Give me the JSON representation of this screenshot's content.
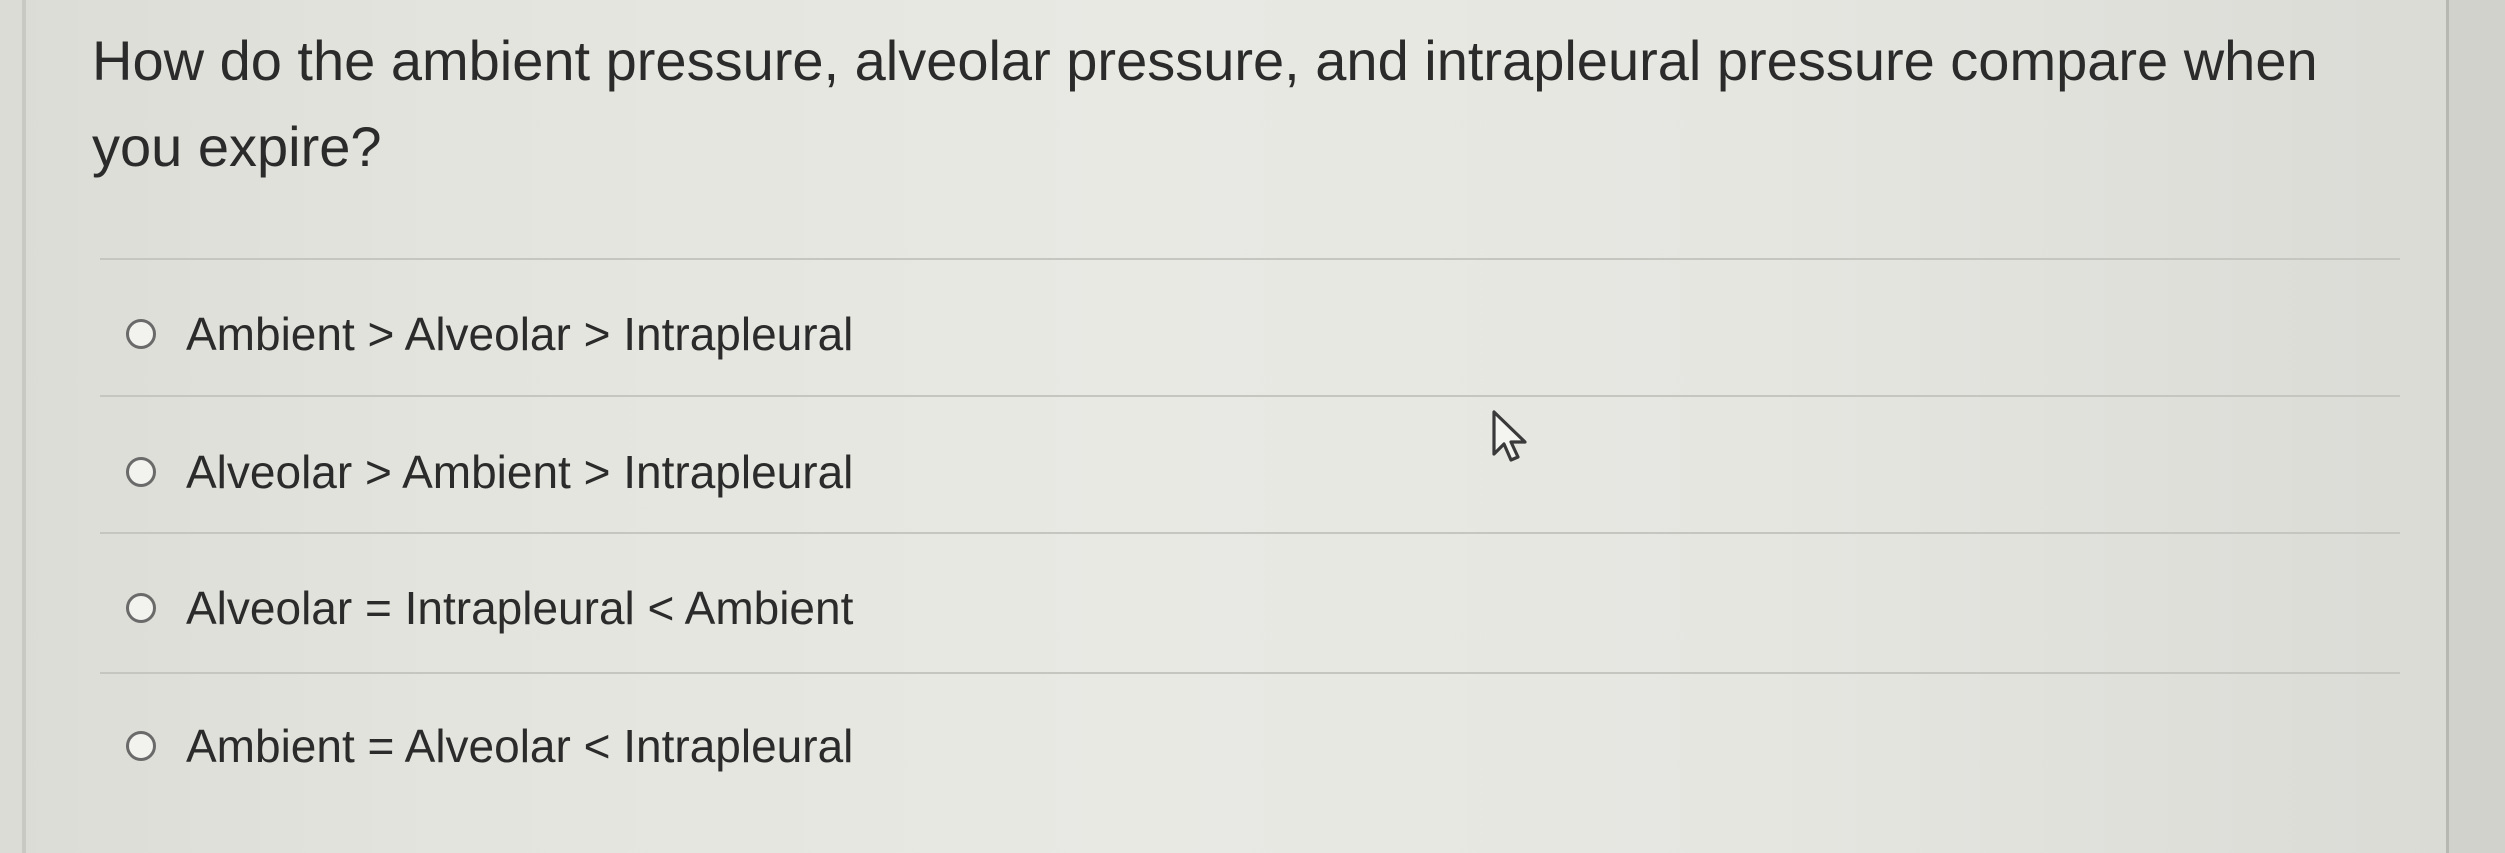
{
  "question": {
    "text": "How do the ambient pressure, alveolar pressure, and intrapleural pressure compare when you expire?"
  },
  "options": [
    {
      "label": "Ambient > Alveolar > Intrapleural",
      "selected": false
    },
    {
      "label": "Alveolar > Ambient > Intrapleural",
      "selected": false
    },
    {
      "label": "Alveolar = Intrapleural < Ambient",
      "selected": false
    },
    {
      "label": "Ambient = Alveolar < Intrapleural",
      "selected": false
    }
  ],
  "cursor": {
    "icon": "mouse-pointer-icon"
  },
  "colors": {
    "background": "#e6e6e1",
    "text": "#2b2b2b",
    "radio_border": "#6a6a6a",
    "divider": "#c6c6c1"
  }
}
